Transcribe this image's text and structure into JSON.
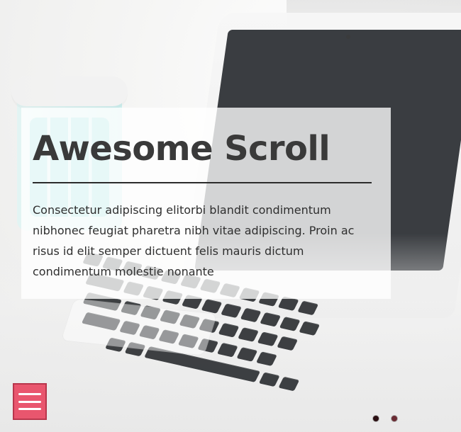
{
  "hero": {
    "title": "Awesome Scroll",
    "body": "Consectetur adipiscing elitorbi blandit condimentum nibhonec feugiat pharetra nibh vitae adipiscing. Proin ac risus id elit semper dictuent felis mauris dictum condimentum molestie nonante"
  },
  "colors": {
    "menu_button_bg": "#e9566e",
    "menu_button_border": "#b8364c",
    "title_text": "#3a3a3a",
    "body_text": "#2f2f2f",
    "rule": "#2b2b2b",
    "pager_dot": "#6a2b33",
    "pager_dot_active": "#2b0f12"
  },
  "icons": {
    "menu": "hamburger-menu-icon"
  },
  "pager": {
    "active_index": 0,
    "count": 2
  }
}
